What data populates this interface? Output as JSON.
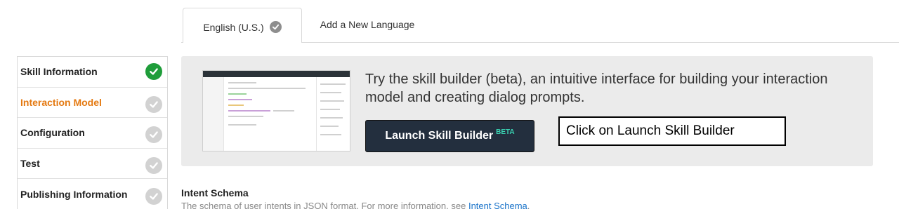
{
  "tabs": {
    "active_label": "English (U.S.)",
    "add_label": "Add a New Language"
  },
  "sidebar": {
    "items": [
      {
        "label": "Skill Information",
        "status": "complete"
      },
      {
        "label": "Interaction Model",
        "status": "current"
      },
      {
        "label": "Configuration",
        "status": "pending"
      },
      {
        "label": "Test",
        "status": "pending"
      },
      {
        "label": "Publishing Information",
        "status": "pending"
      }
    ]
  },
  "banner": {
    "text": "Try the skill builder (beta), an intuitive interface for building your interaction model and creating dialog prompts.",
    "button_label": "Launch Skill Builder",
    "button_badge": "BETA"
  },
  "callout": {
    "text": "Click on Launch Skill Builder"
  },
  "intent_schema": {
    "title": "Intent Schema",
    "description": "The schema of user intents in JSON format. For more information, see",
    "link_text": "Intent Schema",
    "trailing": "."
  },
  "colors": {
    "accent_orange": "#e47911",
    "complete_green": "#1f9d3a",
    "pending_gray": "#d2d2d2",
    "button_dark": "#232f3e",
    "beta_teal": "#3ad4b3",
    "link_blue": "#1a73c9"
  },
  "icons": {
    "tab_status": "check-circle-icon",
    "sidebar_status": "check-circle-icon"
  }
}
